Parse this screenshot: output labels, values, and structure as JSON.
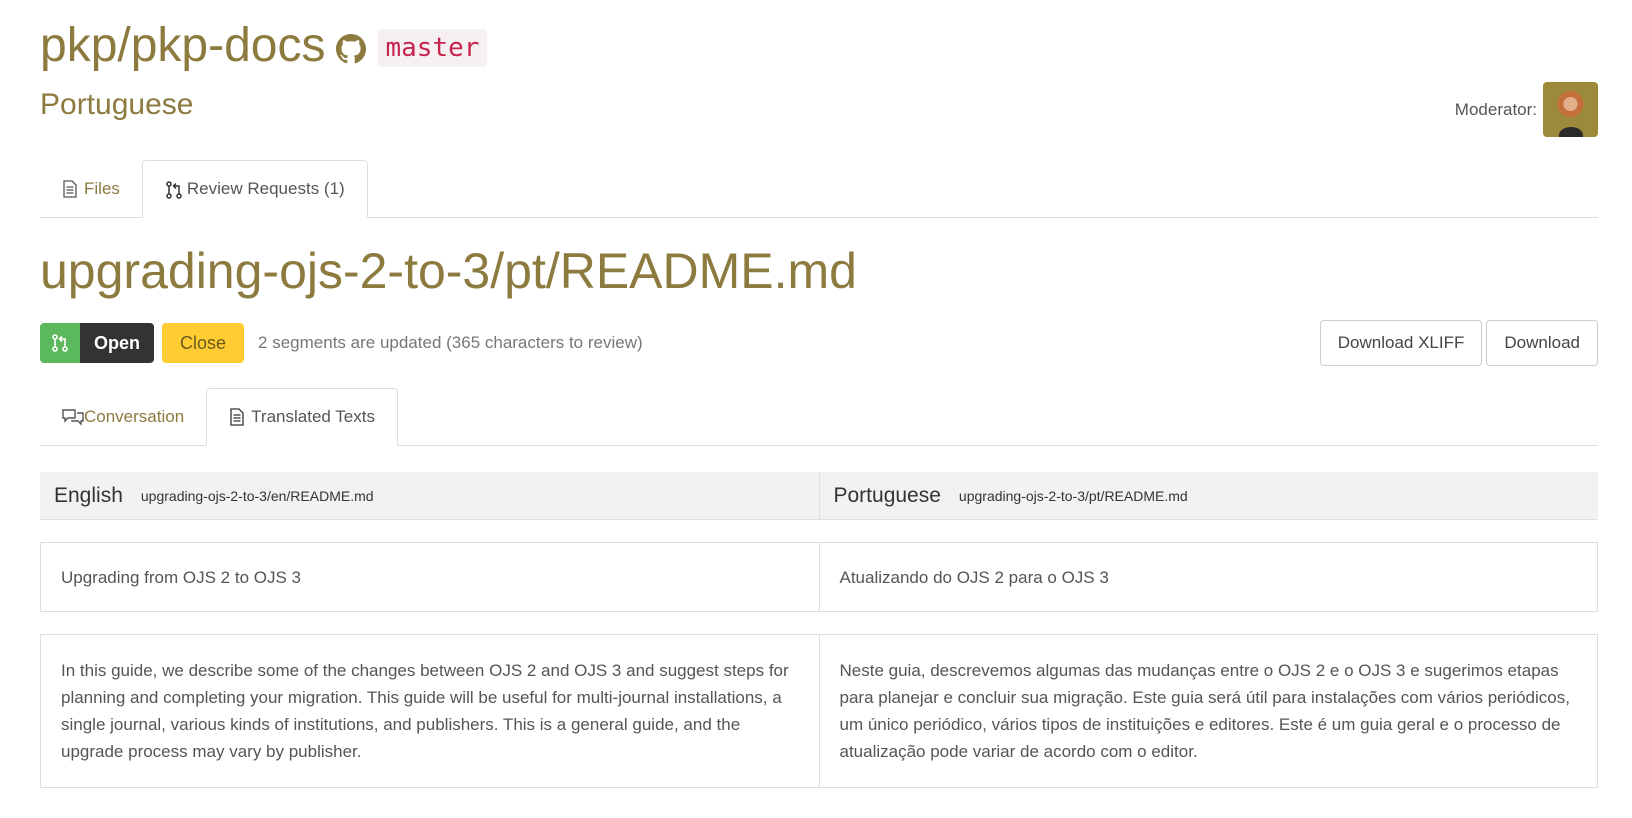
{
  "header": {
    "repo": "pkp/pkp-docs",
    "branch": "master",
    "language": "Portuguese",
    "moderator_label": "Moderator:"
  },
  "main_tabs": [
    {
      "label": "Files",
      "icon": "file-icon",
      "active": false
    },
    {
      "label": "Review Requests (1)",
      "icon": "pull-request-icon",
      "active": true
    }
  ],
  "review": {
    "file_title": "upgrading-ojs-2-to-3/pt/README.md",
    "state_label": "Open",
    "close_label": "Close",
    "status_text": "2 segments are updated (365 characters to review)",
    "download_xliff_label": "Download XLIFF",
    "download_label": "Download"
  },
  "review_tabs": [
    {
      "label": "Conversation",
      "icon": "comments-icon",
      "active": false
    },
    {
      "label": "Translated Texts",
      "icon": "file-icon",
      "active": true
    }
  ],
  "compare": {
    "source": {
      "language": "English",
      "path": "upgrading-ojs-2-to-3/en/README.md"
    },
    "target": {
      "language": "Portuguese",
      "path": "upgrading-ojs-2-to-3/pt/README.md"
    },
    "segments": [
      {
        "source": "Upgrading from OJS 2 to OJS 3",
        "target": "Atualizando do OJS 2 para o OJS 3"
      },
      {
        "source": "In this guide, we describe some of the changes between OJS 2 and OJS 3 and suggest steps for planning and completing your migration. This guide will be useful for multi-journal installations, a single journal, various kinds of institutions, and publishers. This is a general guide, and the upgrade process may vary by publisher.",
        "target": "Neste guia, descrevemos algumas das mudanças entre o OJS 2 e o OJS 3 e sugerimos etapas para planejar e concluir sua migração. Este guia será útil para instalações com vários periódicos, um único periódico, vários tipos de instituições e editores. Este é um guia geral e o processo de atualização pode variar de acordo com o editor."
      }
    ]
  },
  "colors": {
    "accent": "#8c7a3f",
    "open_green": "#5cb85c",
    "close_yellow": "#ffcc33",
    "branch_text": "#c7254e"
  }
}
